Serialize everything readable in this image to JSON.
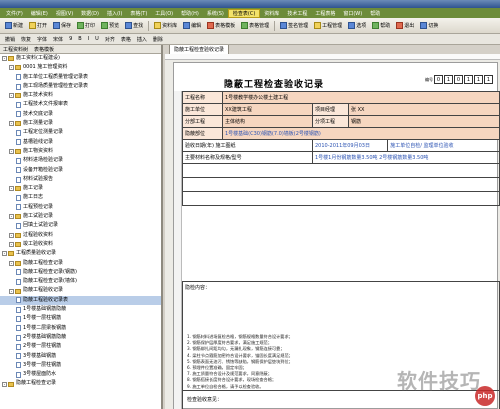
{
  "menu": [
    "文件(F)",
    "编辑(E)",
    "视图(V)",
    "数据(D)",
    "插入(I)",
    "表格(T)",
    "工具(O)",
    "帮助(H)",
    "系统(S)",
    "检查表(C)",
    "资料库",
    "技术工程",
    "工程表格",
    "窗口(W)",
    "帮助"
  ],
  "menu_selected": 9,
  "toolbar1": [
    "新建",
    "打开",
    "保存",
    "打印",
    "预览",
    "查找",
    "资料库",
    "编辑",
    "表格模板",
    "表格管理",
    "签名管理",
    "工程管理",
    "选项",
    "帮助",
    "退出",
    "切换"
  ],
  "toolbar2": [
    "撤销",
    "恢复",
    "字体",
    "宋体",
    "9",
    "B",
    "I",
    "U",
    "对齐",
    "表格",
    "插入",
    "删除"
  ],
  "left_tabs": [
    "工程资料树",
    "表格模板"
  ],
  "tree": [
    {
      "indent": 0,
      "type": "folder",
      "label": "施工资料(工程建设)"
    },
    {
      "indent": 1,
      "type": "folder",
      "label": "0001 施工管理资料"
    },
    {
      "indent": 2,
      "type": "doc",
      "label": "施工单位工程质量管理记录表"
    },
    {
      "indent": 2,
      "type": "doc",
      "label": "施工现场质量管理检查记录表"
    },
    {
      "indent": 1,
      "type": "folder",
      "label": "施工技术资料"
    },
    {
      "indent": 2,
      "type": "doc",
      "label": "工程技术文件报审表"
    },
    {
      "indent": 2,
      "type": "doc",
      "label": "技术交底记录"
    },
    {
      "indent": 1,
      "type": "folder",
      "label": "施工测量记录"
    },
    {
      "indent": 2,
      "type": "doc",
      "label": "工程定位测量记录"
    },
    {
      "indent": 2,
      "type": "doc",
      "label": "基槽验线记录"
    },
    {
      "indent": 1,
      "type": "folder",
      "label": "施工物资资料"
    },
    {
      "indent": 2,
      "type": "doc",
      "label": "材料进场检验记录"
    },
    {
      "indent": 2,
      "type": "doc",
      "label": "设备开箱检验记录"
    },
    {
      "indent": 2,
      "type": "doc",
      "label": "材料试验报告"
    },
    {
      "indent": 1,
      "type": "folder",
      "label": "施工记录"
    },
    {
      "indent": 2,
      "type": "doc",
      "label": "施工日志"
    },
    {
      "indent": 2,
      "type": "doc",
      "label": "工程预检记录"
    },
    {
      "indent": 1,
      "type": "folder",
      "label": "施工试验记录"
    },
    {
      "indent": 2,
      "type": "doc",
      "label": "回填土试验记录"
    },
    {
      "indent": 1,
      "type": "folder",
      "label": "过程验收资料"
    },
    {
      "indent": 1,
      "type": "folder",
      "label": "竣工验收资料"
    },
    {
      "indent": 0,
      "type": "folder",
      "label": "工程质量验收记录"
    },
    {
      "indent": 1,
      "type": "folder",
      "label": "隐蔽工程检查记录"
    },
    {
      "indent": 2,
      "type": "doc",
      "label": "隐蔽工程检查记录(钢筋)"
    },
    {
      "indent": 2,
      "type": "doc",
      "label": "隐蔽工程检查记录(墙体)"
    },
    {
      "indent": 1,
      "type": "folder",
      "label": "隐蔽工程验收记录"
    },
    {
      "indent": 2,
      "type": "doc",
      "label": "隐蔽工程验收记录表",
      "selected": true
    },
    {
      "indent": 2,
      "type": "doc",
      "label": "1号楼基础钢筋隐蔽"
    },
    {
      "indent": 2,
      "type": "doc",
      "label": "1号楼一层柱钢筋"
    },
    {
      "indent": 2,
      "type": "doc",
      "label": "1号楼二层梁板钢筋"
    },
    {
      "indent": 2,
      "type": "doc",
      "label": "2号楼基础钢筋隐蔽"
    },
    {
      "indent": 2,
      "type": "doc",
      "label": "2号楼一层柱钢筋"
    },
    {
      "indent": 2,
      "type": "doc",
      "label": "3号楼基础钢筋"
    },
    {
      "indent": 2,
      "type": "doc",
      "label": "3号楼一层柱钢筋"
    },
    {
      "indent": 2,
      "type": "doc",
      "label": "3号楼屋面防水"
    },
    {
      "indent": 0,
      "type": "folder",
      "label": "隐蔽工程检查记录"
    }
  ],
  "sheet_tab": "隐蔽工程检查验收记录",
  "form": {
    "title": "隐蔽工程检查验收记录",
    "code_label": "编号",
    "code_boxes": [
      "0",
      "1",
      "0",
      "1",
      "1",
      "1"
    ],
    "rows": [
      {
        "label": "工程名称",
        "value": "1号楼教学楼办公楼土建工程"
      },
      {
        "label": "施工单位",
        "value": "XX建筑工程",
        "l2": "项目经理",
        "v2": "张  XX"
      },
      {
        "label": "分部工程",
        "value": "主体结构",
        "l2": "分项工程",
        "v2": "钢筋"
      },
      {
        "label": "隐蔽部位",
        "value": "1号楼基础(C30)钢筋(7.0)墙板(2号楼钢筋)"
      }
    ],
    "date_label": "验收日期(年) 施工图纸",
    "date_value": "2010-2011年09月03日",
    "ref_label": "施工单位自检/ 监理单位验收",
    "item_label": "主要材料名称及规格/型号",
    "item_value": "1号楼1月份钢筋数量3.50吨 2号楼钢筋数量3.50吨",
    "content_label": "隐检内容：",
    "content_lines": [
      "1. 钢筋材料进场复检合格，钢筋规格数量符合设计要求；",
      "2. 钢筋保护层厚度符合要求，满足施工规范；",
      "3. 钢筋绑扎间距均匀，无漏扎现象，钢筋连接可靠；",
      "4. 梁柱节点箍筋加密符合设计要求，锚固长度满足规范；",
      "5. 钢筋表面无油污、锈蚀等缺陷，钢筋保护层垫块到位；",
      "6. 预埋件位置准确，固定牢固；",
      "7. 施工质量符合设计及规范要求，同意隐蔽；",
      "8. 钢筋搭接长度符合设计要求，现场检查合格；",
      "9. 施工单位自检合格，请予以检查验收。"
    ],
    "opinion_label": "检查验收意见："
  },
  "watermark": "软件技巧",
  "watermark_logo": "php"
}
